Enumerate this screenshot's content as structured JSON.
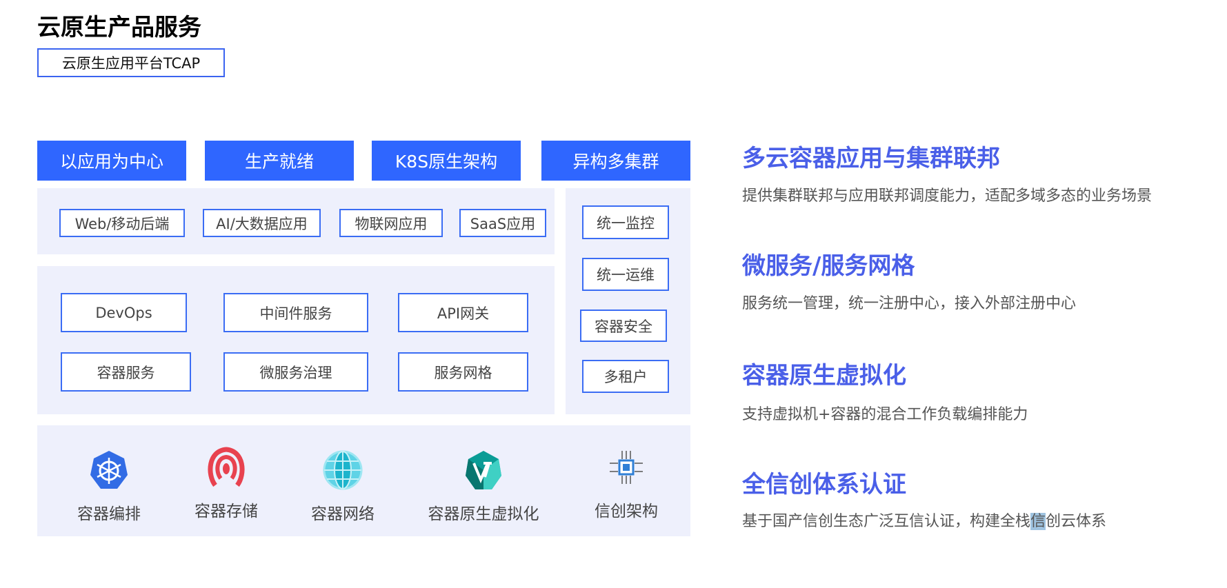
{
  "header": {
    "title": "云原生产品服务",
    "product_tag": "云原生应用平台TCAP"
  },
  "pillars": [
    "以应用为中心",
    "生产就绪",
    "K8S原生架构",
    "异构多集群"
  ],
  "app_layer": [
    "Web/移动后端",
    "AI/大数据应用",
    "物联网应用",
    "SaaS应用"
  ],
  "service_layer": [
    "DevOps",
    "中间件服务",
    "API网关",
    "容器服务",
    "微服务治理",
    "服务网格"
  ],
  "ops_layer": [
    "统一监控",
    "统一运维",
    "容器安全",
    "多租户"
  ],
  "infra_layer": [
    {
      "label": "容器编排",
      "icon": "kubernetes-icon",
      "color": "#326ce5"
    },
    {
      "label": "容器存储",
      "icon": "storage-icon",
      "color": "#e8424f"
    },
    {
      "label": "容器网络",
      "icon": "network-globe-icon",
      "color": "#2cc3d8"
    },
    {
      "label": "容器原生虚拟化",
      "icon": "virtualization-icon",
      "color": "#0a9c96"
    },
    {
      "label": "信创架构",
      "icon": "chip-icon",
      "color": "#2f7fd6"
    }
  ],
  "features": [
    {
      "title": "多云容器应用与集群联邦",
      "desc": "提供集群联邦与应用联邦调度能力，适配多域多态的业务场景"
    },
    {
      "title": "微服务/服务网格",
      "desc": "服务统一管理，统一注册中心，接入外部注册中心"
    },
    {
      "title": "容器原生虚拟化",
      "desc": "支持虚拟机+容器的混合工作负载编排能力"
    },
    {
      "title": "全信创体系认证",
      "desc_before": "基于国产信创生态广泛互信认证，构建全栈",
      "desc_selected": "信",
      "desc_after": "创云体系"
    }
  ]
}
